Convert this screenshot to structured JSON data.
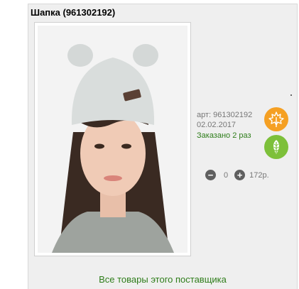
{
  "product": {
    "title": "Шапка (961302192)",
    "article_label": "арт:",
    "article": "961302192",
    "date": "02.02.2017",
    "ordered": "Заказано 2 раз",
    "quantity": "0",
    "price": "172р.",
    "photo_alt": "Шапка"
  },
  "icons": {
    "season_autumn": "maple-leaf-icon",
    "season_spring": "leaf-icon",
    "minus": "minus-icon",
    "plus": "plus-icon"
  },
  "colors": {
    "accent_green": "#2e7d1a",
    "badge_orange": "#f5a023",
    "badge_green": "#7dc03a"
  },
  "footer": {
    "supplier_link": "Все товары этого поставщика"
  }
}
